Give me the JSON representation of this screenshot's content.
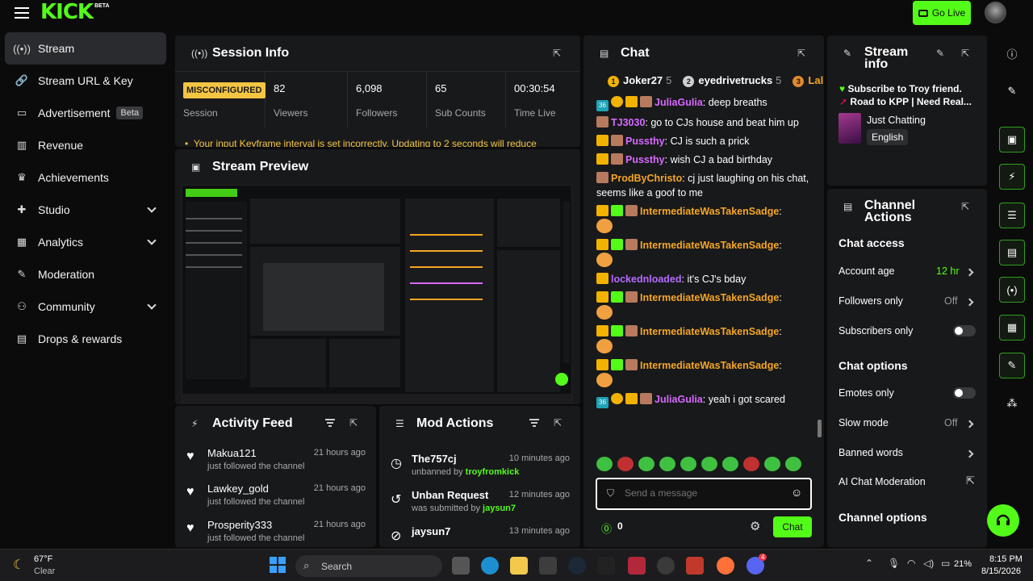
{
  "topbar": {
    "logo": "KICK",
    "logo_badge": "BETA",
    "golive_label": "Go Live"
  },
  "sidebar": {
    "items": [
      {
        "label": "Stream",
        "icon": "broadcast-icon"
      },
      {
        "label": "Stream URL & Key",
        "icon": "link-icon"
      },
      {
        "label": "Advertisement",
        "icon": "ad-icon",
        "badge": "Beta"
      },
      {
        "label": "Revenue",
        "icon": "chart-icon"
      },
      {
        "label": "Achievements",
        "icon": "trophy-icon"
      },
      {
        "label": "Studio",
        "icon": "gamepad-icon"
      },
      {
        "label": "Analytics",
        "icon": "analytics-icon"
      },
      {
        "label": "Moderation",
        "icon": "wrench-icon"
      },
      {
        "label": "Community",
        "icon": "community-icon"
      },
      {
        "label": "Drops & rewards",
        "icon": "gift-icon"
      }
    ]
  },
  "session_info": {
    "title": "Session Info",
    "status": "MISCONFIGURED",
    "status_label": "Session",
    "viewers": "82",
    "viewers_label": "Viewers",
    "followers": "6,098",
    "followers_label": "Followers",
    "subs": "65",
    "subs_label": "Sub Counts",
    "time_live": "00:30:54",
    "time_label": "Time Live",
    "warning": "Your input Keyframe interval is set incorrectly. Updating to 2 seconds will reduce"
  },
  "preview": {
    "title": "Stream Preview"
  },
  "activity": {
    "title": "Activity Feed",
    "items": [
      {
        "name": "Makua121",
        "sub": "just followed the channel",
        "time": "21 hours ago"
      },
      {
        "name": "Lawkey_gold",
        "sub": "just followed the channel",
        "time": "21 hours ago"
      },
      {
        "name": "Prosperity333",
        "sub": "just followed the channel",
        "time": "21 hours ago"
      }
    ]
  },
  "mod_actions": {
    "title": "Mod Actions",
    "items": [
      {
        "name": "The757cj",
        "prefix": "unbanned by ",
        "actor": "troyfromkick",
        "time": "10 minutes ago"
      },
      {
        "name": "Unban Request",
        "prefix": "was submitted by ",
        "actor": "jaysun7",
        "time": "12 minutes ago"
      },
      {
        "name": "jaysun7",
        "prefix": "",
        "actor": "",
        "time": "13 minutes ago"
      }
    ]
  },
  "chat": {
    "title": "Chat",
    "leaders": [
      {
        "rank": "1",
        "name": "Joker27",
        "count": "5",
        "color": "#f2b200"
      },
      {
        "rank": "2",
        "name": "eyedrivetrucks",
        "count": "5",
        "color": "#cfcfcf"
      },
      {
        "rank": "3",
        "name": "Lal",
        "count": "",
        "color": "#e08a2b"
      }
    ],
    "messages": [
      {
        "user": "JuliaGulia",
        "text": ": deep breaths"
      },
      {
        "user": "TJ3030",
        "text": ": go to CJs house and beat him up"
      },
      {
        "user": "Pussthy",
        "text": ": CJ is such a prick"
      },
      {
        "user": "Pussthy",
        "text": ": wish CJ a bad birthday"
      },
      {
        "user": "ProdByChristo",
        "text": ": cj just laughing on his chat, seems like a goof to me"
      },
      {
        "user": "IntermediateWasTakenSadge",
        "text": ":"
      },
      {
        "user": "IntermediateWasTakenSadge",
        "text": ":"
      },
      {
        "user": "lockednloaded",
        "text": ": it's CJ's bday"
      },
      {
        "user": "IntermediateWasTakenSadge",
        "text": ":"
      },
      {
        "user": "IntermediateWasTakenSadge",
        "text": ":"
      },
      {
        "user": "IntermediateWasTakenSadge",
        "text": ":"
      },
      {
        "user": "JuliaGulia",
        "text": ": yeah i got scared"
      }
    ],
    "sub_badge": "36",
    "placeholder": "Send a message",
    "points": "0",
    "send_label": "Chat"
  },
  "stream_info": {
    "title_line1": "Stream",
    "title_line2": "info",
    "line1": "Subscribe to Troy friend.",
    "line2": "Road to KPP | Need Real...",
    "category": "Just Chatting",
    "language": "English"
  },
  "channel_actions": {
    "title_line1": "Channel",
    "title_line2": "Actions",
    "chat_access": "Chat access",
    "account_age": "Account age",
    "account_age_value": "12 hr",
    "followers_only": "Followers only",
    "followers_only_value": "Off",
    "subscribers_only": "Subscribers only",
    "chat_options": "Chat options",
    "emotes_only": "Emotes only",
    "slow_mode": "Slow mode",
    "slow_mode_value": "Off",
    "banned_words": "Banned words",
    "ai_moderation": "AI Chat Moderation",
    "channel_options": "Channel options"
  },
  "taskbar": {
    "weather_temp": "67°F",
    "weather_desc": "Clear",
    "search": "Search",
    "battery": "21%",
    "time": "8:15 PM",
    "date": "8/15/2026",
    "discord_badge": "4"
  },
  "colors": {
    "accent": "#53fc18",
    "warning": "#f4c542",
    "panel": "#18191b"
  }
}
